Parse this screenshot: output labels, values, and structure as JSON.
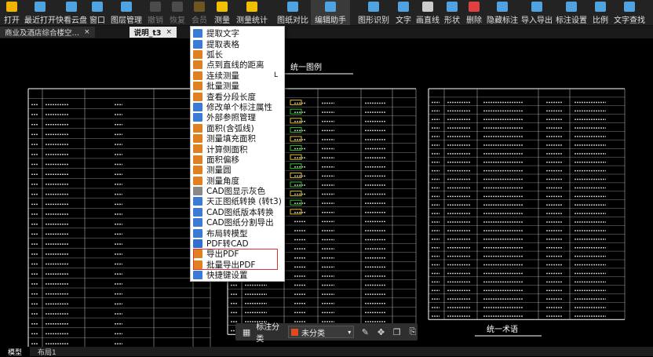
{
  "toolbar": {
    "buttons": [
      {
        "label": "打开",
        "icon": "folder-icon",
        "color": "#f0b400",
        "disabled": false
      },
      {
        "label": "最近打开",
        "icon": "history-icon",
        "color": "#4fa3e0",
        "disabled": false
      },
      {
        "label": "快看云盘",
        "icon": "cloud-icon",
        "color": "#4fa3e0",
        "disabled": false
      },
      {
        "label": "窗口",
        "icon": "window-icon",
        "color": "#4fa3e0",
        "disabled": false
      },
      {
        "label": "图层管理",
        "icon": "layers-icon",
        "color": "#4fa3e0",
        "disabled": false
      },
      {
        "label": "撤销",
        "icon": "undo-icon",
        "color": "#888888",
        "disabled": true
      },
      {
        "label": "恢复",
        "icon": "redo-icon",
        "color": "#888888",
        "disabled": true
      },
      {
        "label": "会员",
        "icon": "vip-icon",
        "color": "#e0a020",
        "disabled": true
      },
      {
        "label": "测量",
        "icon": "ruler-icon",
        "color": "#f0c000",
        "disabled": false
      },
      {
        "label": "测量统计",
        "icon": "stats-icon",
        "color": "#f0c000",
        "disabled": false
      },
      {
        "label": "图纸对比",
        "icon": "compare-icon",
        "color": "#4fa3e0",
        "disabled": false
      },
      {
        "label": "编辑助手",
        "icon": "edit-assistant-icon",
        "color": "#4fa3e0",
        "disabled": false
      },
      {
        "label": "图形识别",
        "icon": "recognize-icon",
        "color": "#4fa3e0",
        "disabled": false
      },
      {
        "label": "文字",
        "icon": "text-icon",
        "color": "#4fa3e0",
        "disabled": false
      },
      {
        "label": "画直线",
        "icon": "line-icon",
        "color": "#cccccc",
        "disabled": false
      },
      {
        "label": "形状",
        "icon": "shape-icon",
        "color": "#4fa3e0",
        "disabled": false
      },
      {
        "label": "删除",
        "icon": "delete-icon",
        "color": "#e04040",
        "disabled": false
      },
      {
        "label": "隐藏标注",
        "icon": "hide-annotation-icon",
        "color": "#4fa3e0",
        "disabled": false
      },
      {
        "label": "导入导出",
        "icon": "import-export-icon",
        "color": "#4fa3e0",
        "disabled": false
      },
      {
        "label": "标注设置",
        "icon": "annotation-settings-icon",
        "color": "#4fa3e0",
        "disabled": false
      },
      {
        "label": "比例",
        "icon": "scale-icon",
        "color": "#4fa3e0",
        "disabled": false
      },
      {
        "label": "文字查找",
        "icon": "text-search-icon",
        "color": "#4fa3e0",
        "disabled": false
      }
    ]
  },
  "tabs": [
    {
      "label": "商业及酒店综合楼空…",
      "close": "×",
      "active": false
    },
    {
      "label": "说明_t3",
      "close": "×",
      "active": true
    }
  ],
  "menu": {
    "items": [
      {
        "label": "提取文字",
        "icon": "extract-text-icon",
        "color": "#3a7bd5",
        "shortcut": ""
      },
      {
        "label": "提取表格",
        "icon": "extract-table-icon",
        "color": "#3a7bd5",
        "shortcut": ""
      },
      {
        "label": "弧长",
        "icon": "arc-length-icon",
        "color": "#e08020",
        "shortcut": ""
      },
      {
        "label": "点到直线的距离",
        "icon": "point-line-icon",
        "color": "#e08020",
        "shortcut": ""
      },
      {
        "label": "连续测量",
        "icon": "continuous-measure-icon",
        "color": "#e08020",
        "shortcut": "L"
      },
      {
        "label": "批量测量",
        "icon": "batch-measure-icon",
        "color": "#e08020",
        "shortcut": ""
      },
      {
        "label": "查看分段长度",
        "icon": "segment-length-icon",
        "color": "#e08020",
        "shortcut": ""
      },
      {
        "label": "修改单个标注属性",
        "icon": "edit-annotation-icon",
        "color": "#3a7bd5",
        "shortcut": ""
      },
      {
        "label": "外部参照管理",
        "icon": "xref-icon",
        "color": "#3a7bd5",
        "shortcut": ""
      },
      {
        "label": "面积(含弧线)",
        "icon": "area-arc-icon",
        "color": "#e08020",
        "shortcut": ""
      },
      {
        "label": "测量填充面积",
        "icon": "fill-area-icon",
        "color": "#e08020",
        "shortcut": ""
      },
      {
        "label": "计算侧面积",
        "icon": "side-area-icon",
        "color": "#e08020",
        "shortcut": ""
      },
      {
        "label": "面积偏移",
        "icon": "area-offset-icon",
        "color": "#e08020",
        "shortcut": ""
      },
      {
        "label": "测量圆",
        "icon": "measure-circle-icon",
        "color": "#e08020",
        "shortcut": ""
      },
      {
        "label": "测量角度",
        "icon": "measure-angle-icon",
        "color": "#e08020",
        "shortcut": ""
      },
      {
        "label": "CAD图显示灰色",
        "icon": "gray-display-icon",
        "color": "#888888",
        "shortcut": ""
      },
      {
        "label": "天正图纸转换 (转t3)",
        "icon": "tangent-convert-icon",
        "color": "#3a7bd5",
        "shortcut": ""
      },
      {
        "label": "CAD图纸版本转换",
        "icon": "version-convert-icon",
        "color": "#3a7bd5",
        "shortcut": ""
      },
      {
        "label": "CAD图纸分割导出",
        "icon": "split-export-icon",
        "color": "#3a7bd5",
        "shortcut": ""
      },
      {
        "label": "布局转模型",
        "icon": "layout-model-icon",
        "color": "#3a7bd5",
        "shortcut": ""
      },
      {
        "label": "PDF转CAD",
        "icon": "pdf-to-cad-icon",
        "color": "#2f6fd0",
        "shortcut": ""
      },
      {
        "label": "导出PDF",
        "icon": "export-pdf-icon",
        "color": "#e08020",
        "shortcut": ""
      },
      {
        "label": "批量导出PDF",
        "icon": "batch-export-pdf-icon",
        "color": "#e08020",
        "shortcut": ""
      },
      {
        "label": "快捷键设置",
        "icon": "shortcut-settings-icon",
        "color": "#3a7bd5",
        "shortcut": ""
      }
    ]
  },
  "drawing": {
    "title_top": "统一图例",
    "title_bottom": "统一术语"
  },
  "float_bar": {
    "label": "标注分类",
    "selected": "未分类",
    "selected_color": "#e24a1e"
  },
  "status_tabs": [
    "模型",
    "布局1"
  ]
}
